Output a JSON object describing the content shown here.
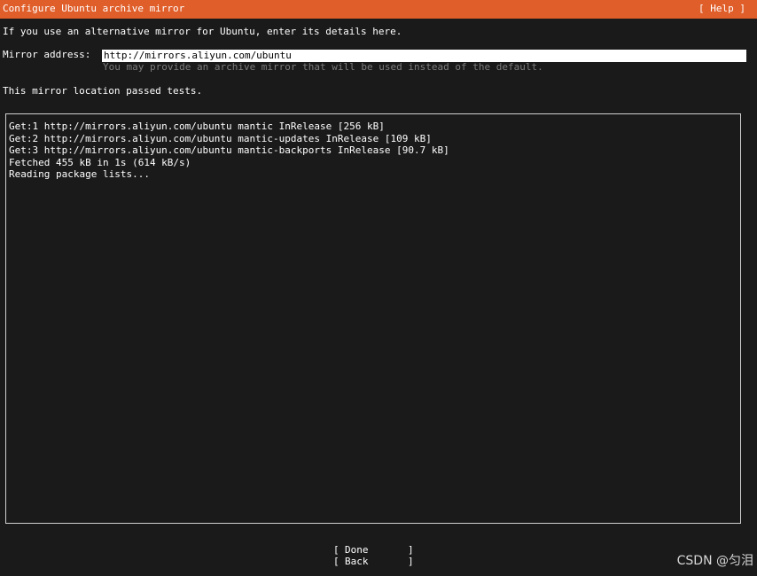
{
  "header": {
    "title": "Configure Ubuntu archive mirror",
    "help_label": "[ Help ]"
  },
  "intro_text": "If you use an alternative mirror for Ubuntu, enter its details here.",
  "mirror": {
    "label": "Mirror address:",
    "value": "http://mirrors.aliyun.com/ubuntu",
    "hint": "You may provide an archive mirror that will be used instead of the default."
  },
  "status_text": "This mirror location passed tests.",
  "log": [
    "Get:1 http://mirrors.aliyun.com/ubuntu mantic InRelease [256 kB]",
    "Get:2 http://mirrors.aliyun.com/ubuntu mantic-updates InRelease [109 kB]",
    "Get:3 http://mirrors.aliyun.com/ubuntu mantic-backports InRelease [90.7 kB]",
    "Fetched 455 kB in 1s (614 kB/s)",
    "Reading package lists..."
  ],
  "buttons": {
    "bracket_open": "[",
    "bracket_close": "]",
    "done": "Done",
    "back": "Back"
  },
  "watermark": "CSDN @匀泪",
  "colors": {
    "header_bg": "#e05e2a",
    "background": "#1a1a1a",
    "hint_text": "#7c7c7c"
  }
}
